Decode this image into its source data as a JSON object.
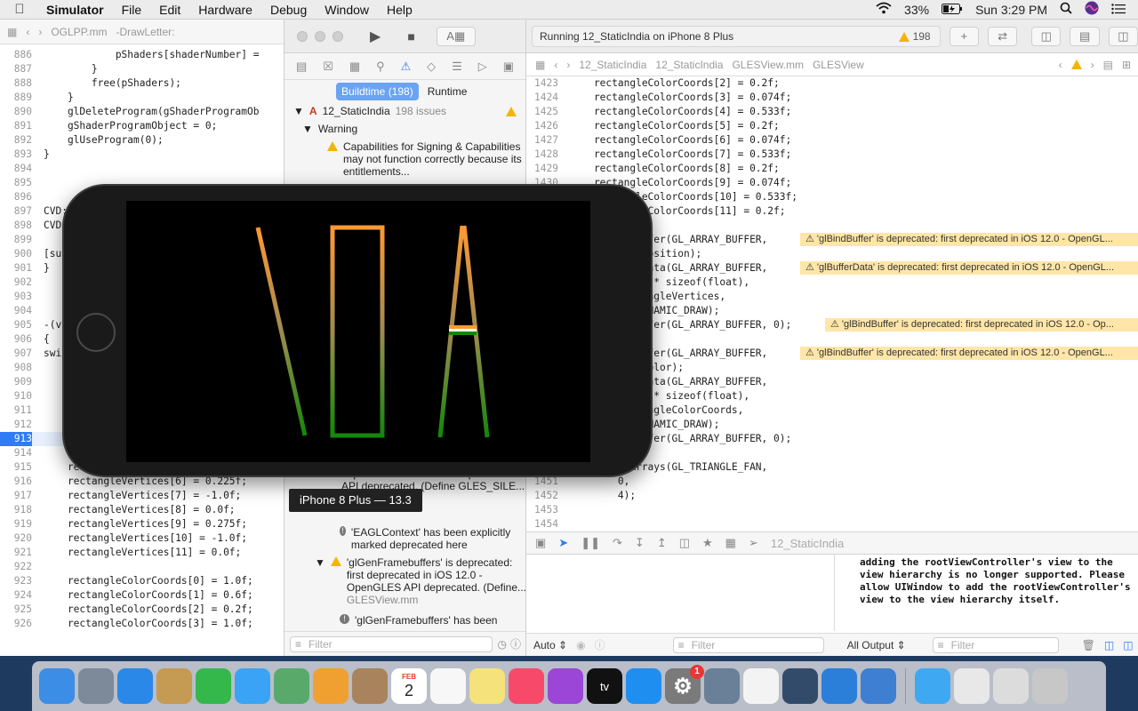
{
  "menubar": {
    "items": [
      "Simulator",
      "File",
      "Edit",
      "Hardware",
      "Debug",
      "Window",
      "Help"
    ],
    "battery": "33%",
    "clock": "Sun 3:29 PM"
  },
  "left_editor": {
    "jump_file": "OGLPP.mm",
    "jump_symbol": "-DrawLetter:",
    "lines": [
      {
        "n": "886",
        "t": "            pShaders[shaderNumber] ="
      },
      {
        "n": "887",
        "t": "        }"
      },
      {
        "n": "888",
        "t": "        free(pShaders);"
      },
      {
        "n": "889",
        "t": "    }"
      },
      {
        "n": "890",
        "t": "    glDeleteProgram(gShaderProgramOb"
      },
      {
        "n": "891",
        "t": "    gShaderProgramObject = 0;"
      },
      {
        "n": "892",
        "t": "    glUseProgram(0);"
      },
      {
        "n": "893",
        "t": "}"
      },
      {
        "n": "894",
        "t": ""
      },
      {
        "n": "895",
        "t": ""
      },
      {
        "n": "896",
        "t": ""
      },
      {
        "n": "897",
        "t": "CVD:"
      },
      {
        "n": "898",
        "t": "CVD:"
      },
      {
        "n": "899",
        "t": ""
      },
      {
        "n": "900",
        "t": "[su"
      },
      {
        "n": "901",
        "t": "}"
      },
      {
        "n": "902",
        "t": ""
      },
      {
        "n": "903",
        "t": ""
      },
      {
        "n": "904",
        "t": ""
      },
      {
        "n": "905",
        "t": "-(vo"
      },
      {
        "n": "906",
        "t": "{"
      },
      {
        "n": "907",
        "t": "swi"
      },
      {
        "n": "908",
        "t": ""
      },
      {
        "n": "909",
        "t": ""
      },
      {
        "n": "910",
        "t": ""
      },
      {
        "n": "911",
        "t": ""
      },
      {
        "n": "912",
        "t": ""
      },
      {
        "n": "913",
        "t": ""
      },
      {
        "n": "914",
        "t": ""
      },
      {
        "n": "915",
        "t": "    rectangleVertices[5] = 0.0f;"
      },
      {
        "n": "916",
        "t": "    rectangleVertices[6] = 0.225f;"
      },
      {
        "n": "917",
        "t": "    rectangleVertices[7] = -1.0f;"
      },
      {
        "n": "918",
        "t": "    rectangleVertices[8] = 0.0f;"
      },
      {
        "n": "919",
        "t": "    rectangleVertices[9] = 0.275f;"
      },
      {
        "n": "920",
        "t": "    rectangleVertices[10] = -1.0f;"
      },
      {
        "n": "921",
        "t": "    rectangleVertices[11] = 0.0f;"
      },
      {
        "n": "922",
        "t": ""
      },
      {
        "n": "923",
        "t": "    rectangleColorCoords[0] = 1.0f;"
      },
      {
        "n": "924",
        "t": "    rectangleColorCoords[1] = 0.6f;"
      },
      {
        "n": "925",
        "t": "    rectangleColorCoords[2] = 0.2f;"
      },
      {
        "n": "926",
        "t": "    rectangleColorCoords[3] = 1.0f;"
      }
    ]
  },
  "navigator": {
    "tab_buildtime": "Buildtime (198)",
    "tab_runtime": "Runtime",
    "project": "12_StaticIndia",
    "project_issues": "198 issues",
    "group": "Warning",
    "issue1": "Capabilities for Signing & Capabilities may not function correctly because its entitlements...",
    "issue2_tail": "deprecated in iOS 12.0 - OpenGLES API deprecated. (Define GLES_SILE...",
    "issue2_file": "GLESView.mm",
    "issue3": "'EAGLContext' has been explicitly marked deprecated here",
    "issue4": "'glGenFramebuffers' is deprecated: first deprecated in iOS 12.0 - OpenGLES API deprecated. (Define...",
    "issue4_file": "GLESView.mm",
    "issue5": "'glGenFramebuffers' has been",
    "filter_placeholder": "Filter"
  },
  "right_editor": {
    "run_status": "Running 12_StaticIndia on iPhone 8 Plus",
    "warning_count": "198",
    "breadcrumb": [
      "12_StaticIndia",
      "12_StaticIndia",
      "GLESView.mm",
      "GLESView"
    ],
    "lines": [
      {
        "n": "1423",
        "t": "    rectangleColorCoords[2] = 0.2f;"
      },
      {
        "n": "1424",
        "t": "    rectangleColorCoords[3] = 0.074f;"
      },
      {
        "n": "1425",
        "t": "    rectangleColorCoords[4] = 0.533f;"
      },
      {
        "n": "1426",
        "t": "    rectangleColorCoords[5] = 0.2f;"
      },
      {
        "n": "1427",
        "t": "    rectangleColorCoords[6] = 0.074f;"
      },
      {
        "n": "1428",
        "t": "    rectangleColorCoords[7] = 0.533f;"
      },
      {
        "n": "1429",
        "t": "    rectangleColorCoords[8] = 0.2f;"
      },
      {
        "n": "1430",
        "t": "    rectangleColorCoords[9] = 0.074f;"
      },
      {
        "n": "1431",
        "t": "    rectangleColorCoords[10] = 0.533f;"
      },
      {
        "n": "1432",
        "t": "    rectangleColorCoords[11] = 0.2f;"
      },
      {
        "n": "1433",
        "t": ""
      },
      {
        "n": "1434",
        "t": "    glBindBuffer(GL_ARRAY_BUFFER,"
      },
      {
        "n": "1435",
        "t": "        vbo_position);"
      },
      {
        "n": "1436",
        "t": "    glBufferData(GL_ARRAY_BUFFER,"
      },
      {
        "n": "1437",
        "t": "        4 * 3 * sizeof(float),"
      },
      {
        "n": "1438",
        "t": "        rectangleVertices,"
      },
      {
        "n": "1439",
        "t": "        GL_DYNAMIC_DRAW);"
      },
      {
        "n": "1440",
        "t": "    glBindBuffer(GL_ARRAY_BUFFER, 0);"
      },
      {
        "n": "1441",
        "t": ""
      },
      {
        "n": "1442",
        "t": "    glBindBuffer(GL_ARRAY_BUFFER,"
      },
      {
        "n": "1443",
        "t": "        vbo_color);"
      },
      {
        "n": "1444",
        "t": "    glBufferData(GL_ARRAY_BUFFER,"
      },
      {
        "n": "1445",
        "t": "        4 * 3 * sizeof(float),"
      },
      {
        "n": "1446",
        "t": "        rectangleColorCoords,"
      },
      {
        "n": "1447",
        "t": "        GL_DYNAMIC_DRAW);"
      },
      {
        "n": "1448",
        "t": "    glBindBuffer(GL_ARRAY_BUFFER, 0);"
      },
      {
        "n": "1449",
        "t": ""
      },
      {
        "n": "1450",
        "t": "    glDrawArrays(GL_TRIANGLE_FAN,"
      },
      {
        "n": "1451",
        "t": "        0,"
      },
      {
        "n": "1452",
        "t": "        4);"
      },
      {
        "n": "1453",
        "t": ""
      },
      {
        "n": "1454",
        "t": ""
      }
    ],
    "issue_banners": [
      "'glBindBuffer' is deprecated: first deprecated in iOS 12.0 - OpenGL...",
      "'glBufferData' is deprecated: first deprecated in iOS 12.0 - OpenGL...",
      "'glBindBuffer' is deprecated: first deprecated in iOS 12.0 - Op...",
      "'glBindBuffer' is deprecated: first deprecated in iOS 12.0 - OpenGL..."
    ],
    "debug_target": "12_StaticIndia",
    "console": "adding the rootViewController's view to the view hierarchy is no longer supported. Please allow UIWindow to add the rootViewController's view to the view hierarchy itself.",
    "auto_label": "Auto",
    "all_output_label": "All Output",
    "filter_placeholder": "Filter"
  },
  "simulator": {
    "device_label": "iPhone 8 Plus — 13.3",
    "app_letters": [
      "I",
      "N",
      "D",
      "I",
      "A"
    ],
    "flag_colors": {
      "saffron": "#FF9933",
      "white": "#FFFFFF",
      "green": "#138808"
    }
  },
  "dock": {
    "apps": [
      "Finder",
      "Launchpad",
      "Safari",
      "Preview",
      "FaceTime",
      "Messages",
      "Maps",
      "Photos",
      "Contacts",
      "Calendar",
      "Reminders",
      "Notes",
      "Music",
      "Podcasts",
      "TV",
      "App Store",
      "System Preferences",
      "Image Capture",
      "TextEdit",
      "QuickTime",
      "Xcode",
      "Simulator",
      "Downloads",
      "Desktop",
      "Documents",
      "Trash"
    ],
    "calendar_month": "FEB",
    "calendar_day": "2",
    "prefs_badge": "1",
    "tv_label": "tv"
  }
}
